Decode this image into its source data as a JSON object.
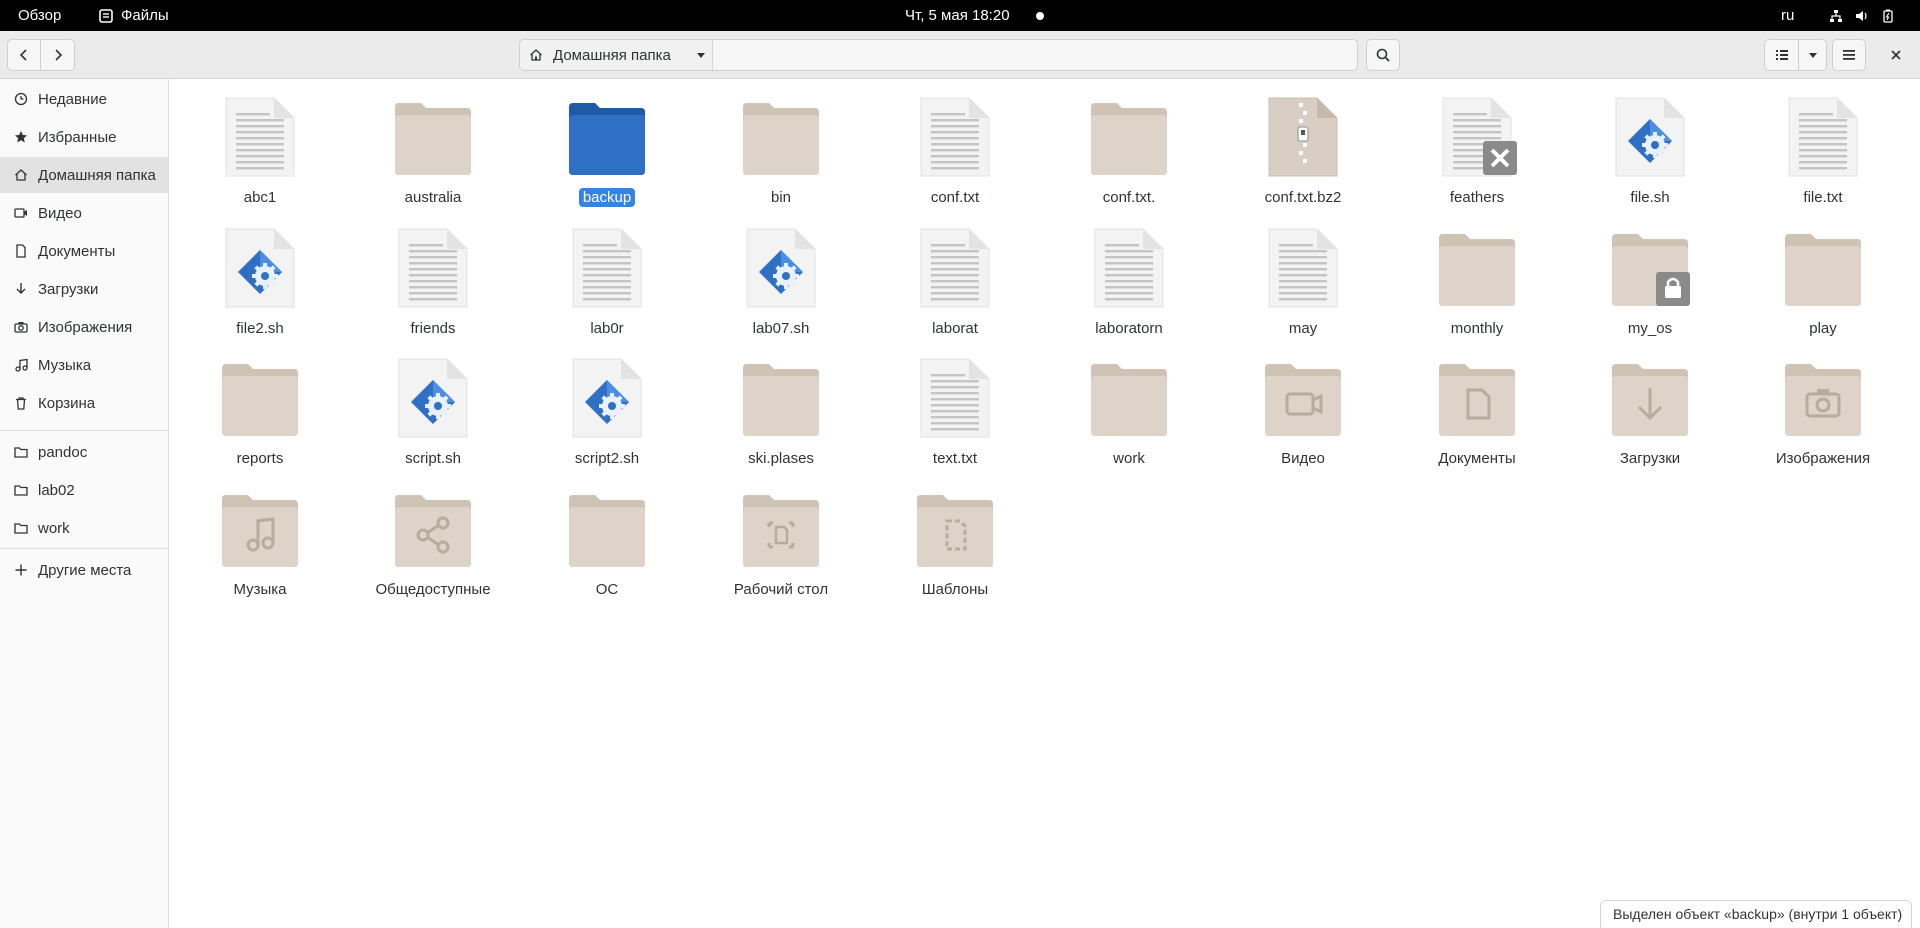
{
  "topbar": {
    "overview": "Обзор",
    "app_name": "Файлы",
    "clock": "Чт, 5 мая  18:20",
    "lang": "ru"
  },
  "header": {
    "path_label": "Домашняя папка"
  },
  "sidebar": {
    "items": [
      {
        "label": "Недавние",
        "icon": "clock-icon"
      },
      {
        "label": "Избранные",
        "icon": "star-icon"
      },
      {
        "label": "Домашняя папка",
        "icon": "home-icon",
        "active": true
      },
      {
        "label": "Видео",
        "icon": "video-icon"
      },
      {
        "label": "Документы",
        "icon": "document-icon"
      },
      {
        "label": "Загрузки",
        "icon": "download-icon"
      },
      {
        "label": "Изображения",
        "icon": "camera-icon"
      },
      {
        "label": "Музыка",
        "icon": "music-icon"
      },
      {
        "label": "Корзина",
        "icon": "trash-icon"
      }
    ],
    "bookmarks": [
      {
        "label": "pandoc",
        "icon": "folder-icon"
      },
      {
        "label": "lab02",
        "icon": "folder-icon"
      },
      {
        "label": "work",
        "icon": "folder-icon"
      }
    ],
    "other": {
      "label": "Другие места",
      "icon": "plus-icon"
    }
  },
  "files": [
    {
      "name": "abc1",
      "type": "text"
    },
    {
      "name": "australia",
      "type": "folder"
    },
    {
      "name": "backup",
      "type": "folder",
      "selected": true
    },
    {
      "name": "bin",
      "type": "folder"
    },
    {
      "name": "conf.txt",
      "type": "text"
    },
    {
      "name": "conf.txt.",
      "type": "folder"
    },
    {
      "name": "conf.txt.bz2",
      "type": "archive"
    },
    {
      "name": "feathers",
      "type": "broken"
    },
    {
      "name": "file.sh",
      "type": "script"
    },
    {
      "name": "file.txt",
      "type": "text"
    },
    {
      "name": "file2.sh",
      "type": "script"
    },
    {
      "name": "friends",
      "type": "text"
    },
    {
      "name": "lab0r",
      "type": "text"
    },
    {
      "name": "lab07.sh",
      "type": "script"
    },
    {
      "name": "laborat",
      "type": "text"
    },
    {
      "name": "laboratorn",
      "type": "text"
    },
    {
      "name": "may",
      "type": "text"
    },
    {
      "name": "monthly",
      "type": "folder"
    },
    {
      "name": "my_os",
      "type": "locked"
    },
    {
      "name": "play",
      "type": "folder"
    },
    {
      "name": "reports",
      "type": "folder"
    },
    {
      "name": "script.sh",
      "type": "script"
    },
    {
      "name": "script2.sh",
      "type": "script"
    },
    {
      "name": "ski.plases",
      "type": "folder"
    },
    {
      "name": "text.txt",
      "type": "text"
    },
    {
      "name": "work",
      "type": "folder"
    },
    {
      "name": "Видео",
      "type": "folder-video"
    },
    {
      "name": "Документы",
      "type": "folder-docs"
    },
    {
      "name": "Загрузки",
      "type": "folder-download"
    },
    {
      "name": "Изображения",
      "type": "folder-pictures"
    },
    {
      "name": "Музыка",
      "type": "folder-music"
    },
    {
      "name": "Общедоступные",
      "type": "folder-share"
    },
    {
      "name": "ОС",
      "type": "folder"
    },
    {
      "name": "Рабочий стол",
      "type": "folder-desktop"
    },
    {
      "name": "Шаблоны",
      "type": "folder-templates"
    }
  ],
  "status": "Выделен объект «backup»  (внутри 1 объект)",
  "colors": {
    "accent": "#3584e4",
    "folder": "#ddd3c8",
    "folder_selected": "#2f6fc4"
  }
}
